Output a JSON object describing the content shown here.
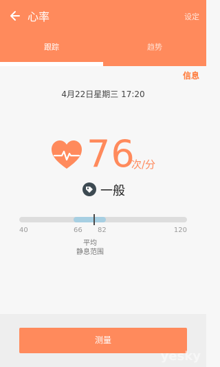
{
  "header": {
    "title": "心率",
    "settings_label": "设定",
    "tabs": [
      {
        "label": "跟踪",
        "selected": true
      },
      {
        "label": "趋势",
        "selected": false
      }
    ]
  },
  "main": {
    "info_link": "信息",
    "datetime": "4月22日星期三 17:20",
    "bpm": "76",
    "unit": "次/分",
    "status": "一般",
    "range": {
      "min": "40",
      "low": "66",
      "high": "82",
      "max": "120",
      "average_label": "平均",
      "resting_label": "静息范围",
      "current_value": 76
    }
  },
  "footer": {
    "measure_label": "测量"
  },
  "watermark": "yesky",
  "colors": {
    "accent": "#ff8a5c",
    "range": "#a7cfe2",
    "track": "#dddddd"
  },
  "icons": {
    "back": "arrow-left-icon",
    "heart": "heart-icon",
    "tag": "tag-icon"
  }
}
